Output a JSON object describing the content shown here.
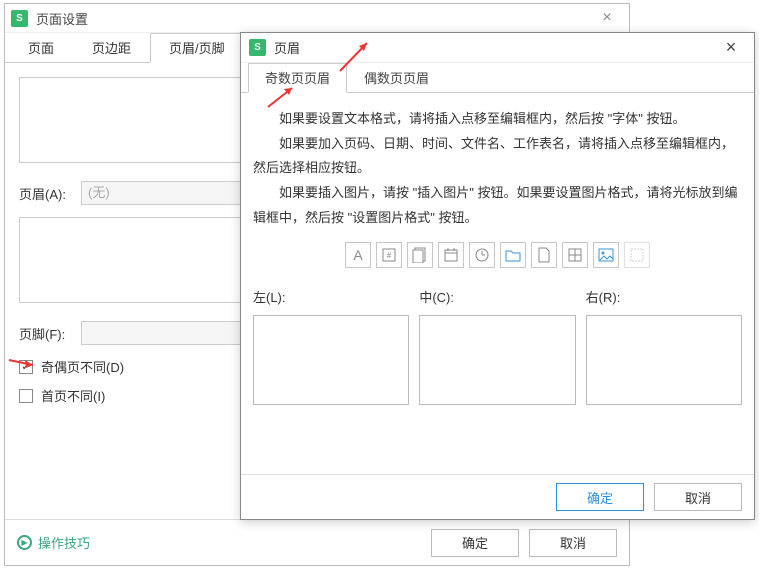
{
  "bg": {
    "title": "页面设置",
    "tabs": {
      "page": "页面",
      "margins": "页边距",
      "headerfooter": "页眉/页脚"
    },
    "header_label": "页眉(A):",
    "header_value": "(无)",
    "footer_label": "页脚(F):",
    "chk_oddeven": "奇偶页不同(D)",
    "chk_first": "首页不同(I)",
    "tips": "操作技巧",
    "btn_ok": "确定",
    "btn_cancel": "取消"
  },
  "fg": {
    "title": "页眉",
    "tabs": {
      "odd": "奇数页页眉",
      "even": "偶数页页眉"
    },
    "p1": "如果要设置文本格式，请将插入点移至编辑框内，然后按 \"字体\" 按钮。",
    "p2": "如果要加入页码、日期、时间、文件名、工作表名，请将插入点移至编辑框内，然后选择相应按钮。",
    "p3": "如果要插入图片，请按 \"插入图片\" 按钮。如果要设置图片格式，请将光标放到编辑框中，然后按 \"设置图片格式\" 按钮。",
    "icons": {
      "font": "A",
      "page": "#",
      "pages": "##",
      "date": "date",
      "time": "time",
      "file": "file",
      "sheet": "sheet",
      "tabs": "tabs",
      "pic": "pic",
      "picfmt": "picfmt"
    },
    "left_label": "左(L):",
    "center_label": "中(C):",
    "right_label": "右(R):",
    "btn_ok": "确定",
    "btn_cancel": "取消"
  }
}
